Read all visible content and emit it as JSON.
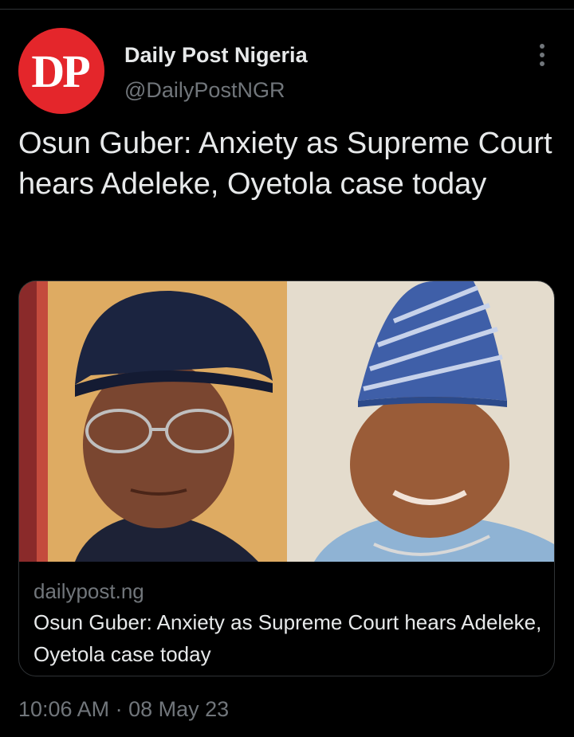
{
  "account": {
    "avatar_text": "DP",
    "display_name": "Daily Post Nigeria",
    "handle": "@DailyPostNGR"
  },
  "tweet": {
    "text": "Osun Guber: Anxiety as Supreme Court hears Adeleke, Oyetola case today"
  },
  "link_card": {
    "domain": "dailypost.ng",
    "title": "Osun Guber: Anxiety as Supreme Court hears Adeleke, Oyetola case today"
  },
  "footer": {
    "time": "10:06 AM",
    "separator": "·",
    "date": "08 May 23"
  },
  "icons": {
    "more": "more-vertical-icon"
  },
  "colors": {
    "background": "#000000",
    "primary_text": "#e7e9ea",
    "secondary_text": "#71767b",
    "border": "#2f3336",
    "avatar_red": "#e4262b"
  }
}
